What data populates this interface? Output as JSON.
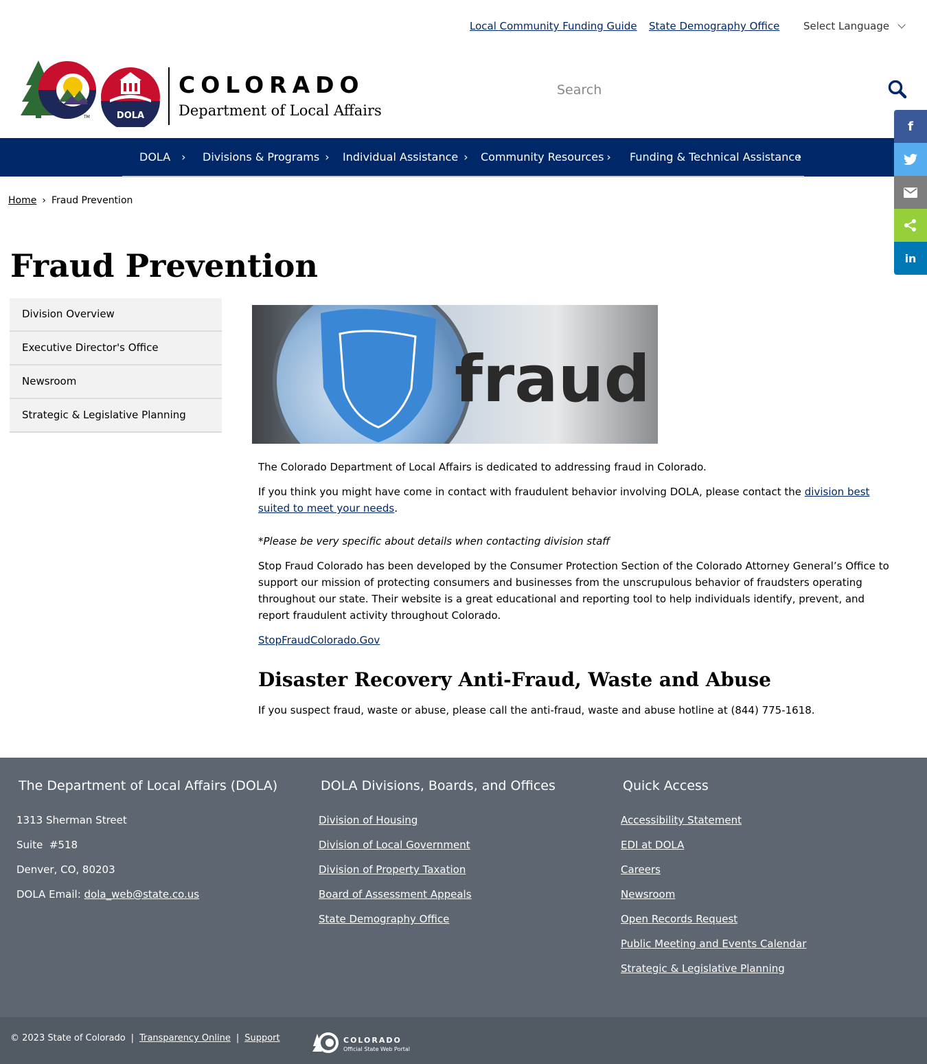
{
  "utility": {
    "links": [
      "Local Community Funding Guide",
      "State Demography Office"
    ],
    "language_label": "Select Language"
  },
  "brand": {
    "state": "COLORADO",
    "department": "Department of Local Affairs",
    "seal_text": "DOLA"
  },
  "search": {
    "placeholder": "Search"
  },
  "nav": {
    "items": [
      "DOLA",
      "Divisions & Programs",
      "Individual Assistance",
      "Community Resources",
      "Funding & Technical Assistance"
    ]
  },
  "share": {
    "facebook": "f",
    "linkedin": "in"
  },
  "breadcrumb": {
    "home": "Home",
    "separator": "›",
    "current": "Fraud Prevention"
  },
  "page": {
    "title": "Fraud Prevention"
  },
  "sidebar": {
    "items": [
      "Division Overview",
      "Executive Director's Office",
      "Newsroom",
      "Strategic & Legislative Planning"
    ]
  },
  "hero": {
    "word": "fraud"
  },
  "content": {
    "p1": "The Colorado Department of Local Affairs is dedicated to addressing fraud in Colorado.",
    "p2_before": "If you think you might have come in contact with fraudulent behavior involving DOLA, please contact the ",
    "p2_link": "division best suited to meet your needs",
    "p2_after": ".",
    "note": "*Please be very specific about details when contacting division staff",
    "p3": "Stop Fraud Colorado has been developed by the Consumer Protection Section of the Colorado Attorney General’s Office to support our mission of protecting consumers and businesses from the unscrupulous behavior of fraudsters operating throughout our state. Their website is a great educational and reporting tool to help individuals identify, prevent, and report fraudulent activity throughout Colorado.",
    "p3_link": "StopFraudColorado.Gov",
    "h2": "Disaster Recovery Anti-Fraud, Waste and Abuse",
    "p4": "If you suspect fraud, waste or abuse, please call the anti-fraud, waste and abuse hotline at (844) 775-1618."
  },
  "footer": {
    "col1": {
      "title": "The Department of Local Affairs (DOLA)",
      "street": "1313 Sherman Street",
      "suite": "Suite  #518",
      "city": "Denver, CO, 80203",
      "email_label": "DOLA Email: ",
      "email": "dola_web@state.co.us"
    },
    "col2": {
      "title": "DOLA Divisions, Boards, and Offices",
      "links": [
        "Division of Housing",
        "Division of Local Government",
        "Division of Property Taxation",
        "Board of Assessment Appeals",
        "State Demography Office"
      ]
    },
    "col3": {
      "title": "Quick Access",
      "links": [
        "Accessibility Statement",
        "EDI at DOLA",
        "Careers",
        "Newsroom",
        "Open Records Request",
        "Public Meeting and Events Calendar",
        "Strategic & Legislative Planning"
      ]
    }
  },
  "bottom": {
    "copyright": "© 2023 State of Colorado",
    "sep": "|",
    "links": [
      "Transparency Online",
      "Support"
    ],
    "portal_name": "COLORADO",
    "portal_sub": "Official State Web Portal"
  },
  "colors": {
    "navy": "#002868",
    "footer": "#5e6771",
    "footer_bottom": "#525a64",
    "co_red": "#c8102e",
    "co_gold": "#f2c500"
  }
}
